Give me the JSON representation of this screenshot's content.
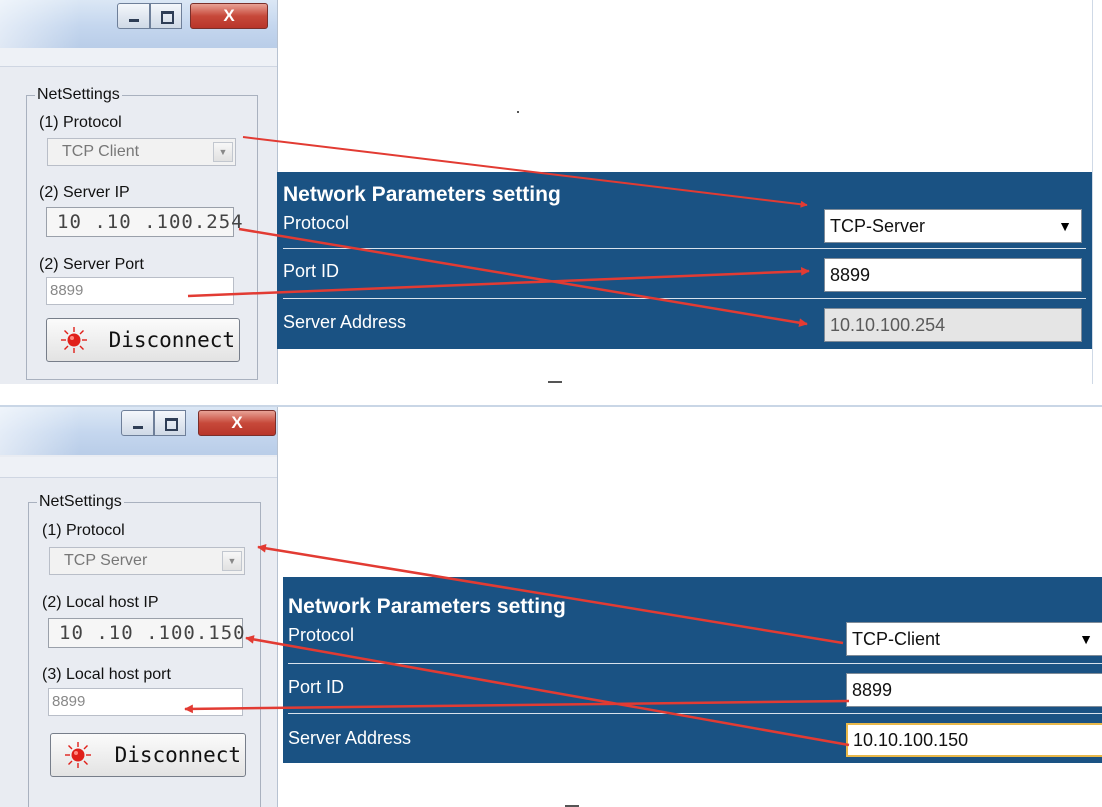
{
  "top": {
    "window": {
      "close_glyph": "X"
    },
    "group_title": "NetSettings",
    "protocol": {
      "label": "(1) Protocol",
      "value": "TCP Client"
    },
    "ip": {
      "label": "(2) Server IP",
      "value": "10 .10 .100.254"
    },
    "port": {
      "label": "(2) Server Port",
      "value": "8899"
    },
    "button": "Disconnect",
    "web": {
      "title": "Network Parameters setting",
      "protocol_label": "Protocol",
      "protocol_value": "TCP-Server",
      "port_label": "Port ID",
      "port_value": "8899",
      "server_label": "Server Address",
      "server_value": "10.10.100.254"
    }
  },
  "bottom": {
    "window": {
      "close_glyph": "X"
    },
    "group_title": "NetSettings",
    "protocol": {
      "label": "(1) Protocol",
      "value": "TCP Server"
    },
    "ip": {
      "label": "(2) Local host IP",
      "value": "10 .10 .100.150"
    },
    "port": {
      "label": "(3) Local host port",
      "value": "8899"
    },
    "button": "Disconnect",
    "web": {
      "title": "Network Parameters setting",
      "protocol_label": "Protocol",
      "protocol_value": "TCP-Client",
      "port_label": "Port ID",
      "port_value": "8899",
      "server_label": "Server Address",
      "server_value": "10.10.100.150"
    }
  },
  "icons": {
    "dropdown": "chevron-down-icon",
    "dropdown_glyph": "▼",
    "led": "red-led-icon",
    "arrow": "red-arrow-icon"
  },
  "colors": {
    "panel_bg": "#1a5283",
    "arrow": "#e23b33",
    "led": "#e0201a"
  }
}
